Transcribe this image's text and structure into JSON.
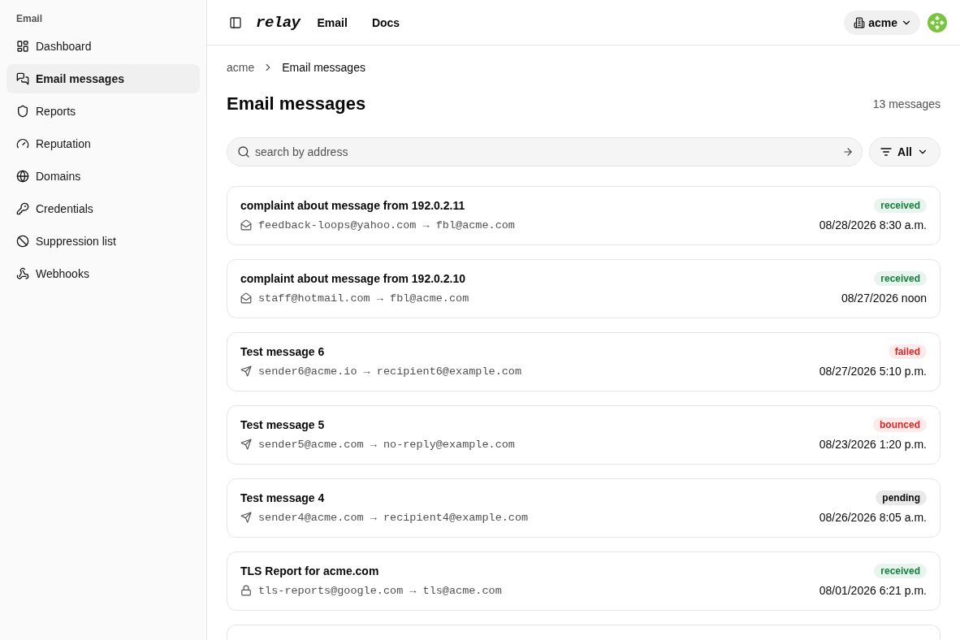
{
  "sidebar": {
    "section": "Email",
    "items": [
      {
        "label": "Dashboard",
        "selected": false
      },
      {
        "label": "Email messages",
        "selected": true
      },
      {
        "label": "Reports",
        "selected": false
      },
      {
        "label": "Reputation",
        "selected": false
      },
      {
        "label": "Domains",
        "selected": false
      },
      {
        "label": "Credentials",
        "selected": false
      },
      {
        "label": "Suppression list",
        "selected": false
      },
      {
        "label": "Webhooks",
        "selected": false
      }
    ]
  },
  "topbar": {
    "logo": "relay",
    "nav": [
      "Email",
      "Docs"
    ],
    "org": "acme"
  },
  "breadcrumb": {
    "parent": "acme",
    "current": "Email messages"
  },
  "page": {
    "title": "Email messages",
    "count": "13 messages"
  },
  "search": {
    "placeholder": "search by address"
  },
  "filter": {
    "label": "All"
  },
  "messages": [
    {
      "kind": "feedback",
      "subject": "complaint about message from 192.0.2.11",
      "addresses": "feedback-loops@yahoo.com → fbl@acme.com",
      "status": "received",
      "color": "#15803d",
      "date": "08/28/2026 8:30 a.m."
    },
    {
      "kind": "feedback",
      "subject": "complaint about message from 192.0.2.10",
      "addresses": "staff@hotmail.com → fbl@acme.com",
      "status": "received",
      "color": "#15803d",
      "date": "08/27/2026 noon"
    },
    {
      "kind": "sent",
      "subject": "Test message 6",
      "addresses": "sender6@acme.io → recipient6@example.com",
      "status": "failed",
      "color": "#dc2626",
      "date": "08/27/2026 5:10 p.m."
    },
    {
      "kind": "sent",
      "subject": "Test message 5",
      "addresses": "sender5@acme.com → no-reply@example.com",
      "status": "bounced",
      "color": "#dc2626",
      "date": "08/23/2026 1:20 p.m."
    },
    {
      "kind": "sent",
      "subject": "Test message 4",
      "addresses": "sender4@acme.com → recipient4@example.com",
      "status": "pending",
      "color": "#0a0a0a",
      "date": "08/26/2026 8:05 a.m."
    },
    {
      "kind": "report",
      "subject": "TLS Report for acme.com",
      "addresses": "tls-reports@google.com → tls@acme.com",
      "status": "received",
      "color": "#15803d",
      "date": "08/01/2026 6:21 p.m."
    }
  ],
  "more_below": true
}
